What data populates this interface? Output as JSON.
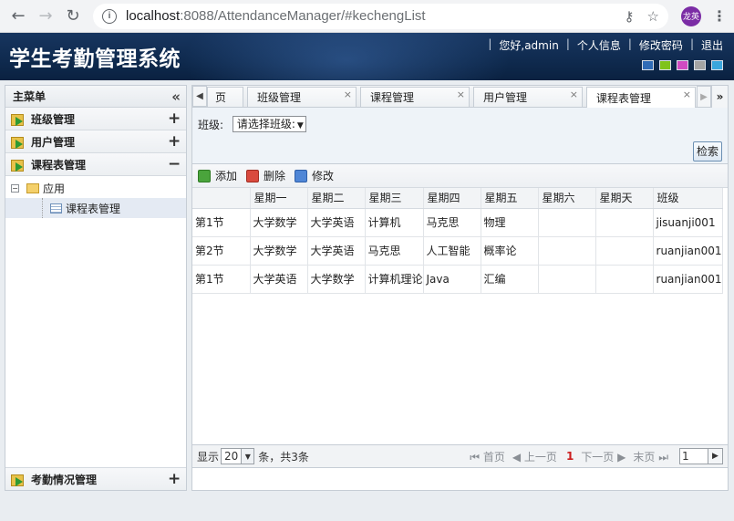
{
  "browser": {
    "host": "localhost",
    "path": ":8088/AttendanceManager/#kechengList",
    "avatar_text": "龙英"
  },
  "header": {
    "title": "学生考勤管理系统",
    "greeting": "您好,admin",
    "profile_link": "个人信息",
    "change_password_link": "修改密码",
    "logout_link": "退出",
    "themes": [
      "#2f6bb7",
      "#7fc31a",
      "#d04bc2",
      "#a4a4a4",
      "#3aa6dd"
    ]
  },
  "sidebar": {
    "title": "主菜单",
    "menus": [
      {
        "label": "班级管理",
        "toggle": "+"
      },
      {
        "label": "用户管理",
        "toggle": "+"
      },
      {
        "label": "课程表管理",
        "toggle": "−"
      }
    ],
    "tree": {
      "root": "应用",
      "root_toggle": "−",
      "child": "课程表管理"
    },
    "bottom_menu": {
      "label": "考勤情况管理",
      "toggle": "+"
    }
  },
  "tabs": {
    "partial_label": "页",
    "items": [
      {
        "label": "班级管理"
      },
      {
        "label": "课程管理"
      },
      {
        "label": "用户管理"
      },
      {
        "label": "课程表管理"
      }
    ],
    "close_glyph": "×"
  },
  "filter": {
    "class_label": "班级:",
    "class_select": "请选择班级:",
    "search_button": "检索"
  },
  "toolbar": {
    "add": "添加",
    "delete": "删除",
    "edit": "修改"
  },
  "grid": {
    "columns": [
      "",
      "星期一",
      "星期二",
      "星期三",
      "星期四",
      "星期五",
      "星期六",
      "星期天",
      "班级"
    ],
    "rows": [
      [
        "第1节",
        "大学数学",
        "大学英语",
        "计算机",
        "马克思",
        "物理",
        "",
        "",
        "jisuanji001"
      ],
      [
        "第2节",
        "大学数学",
        "大学英语",
        "马克思",
        "人工智能",
        "概率论",
        "",
        "",
        "ruanjian001"
      ],
      [
        "第1节",
        "大学英语",
        "大学数学",
        "计算机理论",
        "Java",
        "汇编",
        "",
        "",
        "ruanjian001"
      ]
    ]
  },
  "pager": {
    "show_label": "显示",
    "page_size": "20",
    "count_text": "条，共3条",
    "first": "首页",
    "prev": "上一页",
    "current": "1",
    "next": "下一页",
    "last": "末页",
    "page_input": "1"
  }
}
